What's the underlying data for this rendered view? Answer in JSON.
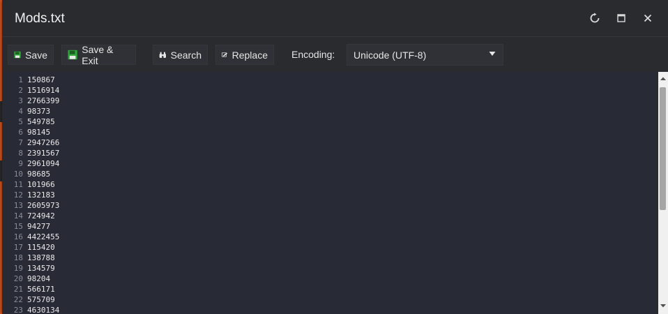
{
  "window": {
    "title": "Mods.txt"
  },
  "toolbar": {
    "save_label": "Save",
    "save_exit_label": "Save & Exit",
    "search_label": "Search",
    "replace_label": "Replace",
    "encoding_label": "Encoding:",
    "encoding_value": "Unicode (UTF-8)"
  },
  "editor": {
    "lines": [
      {
        "n": "1",
        "text": "150867"
      },
      {
        "n": "2",
        "text": "1516914"
      },
      {
        "n": "3",
        "text": "2766399"
      },
      {
        "n": "4",
        "text": "98373"
      },
      {
        "n": "5",
        "text": "549785"
      },
      {
        "n": "6",
        "text": "98145"
      },
      {
        "n": "7",
        "text": "2947266"
      },
      {
        "n": "8",
        "text": "2391567"
      },
      {
        "n": "9",
        "text": "2961094"
      },
      {
        "n": "10",
        "text": "98685"
      },
      {
        "n": "11",
        "text": "101966"
      },
      {
        "n": "12",
        "text": "132183"
      },
      {
        "n": "13",
        "text": "2605973"
      },
      {
        "n": "14",
        "text": "724942"
      },
      {
        "n": "15",
        "text": "94277"
      },
      {
        "n": "16",
        "text": "4422455"
      },
      {
        "n": "17",
        "text": "115420"
      },
      {
        "n": "18",
        "text": "138788"
      },
      {
        "n": "19",
        "text": "134579"
      },
      {
        "n": "20",
        "text": "98204"
      },
      {
        "n": "21",
        "text": "566171"
      },
      {
        "n": "22",
        "text": "575709"
      },
      {
        "n": "23",
        "text": "4630134"
      }
    ]
  },
  "colors": {
    "save_icon": "#2fa63a",
    "accent": "#d9561f"
  },
  "icons": {
    "save": "floppy-disk-icon",
    "search": "binoculars-icon",
    "replace": "replace-icon",
    "refresh": "refresh-icon",
    "maximize": "maximize-icon",
    "close": "close-icon",
    "dropdown": "chevron-down-icon"
  }
}
